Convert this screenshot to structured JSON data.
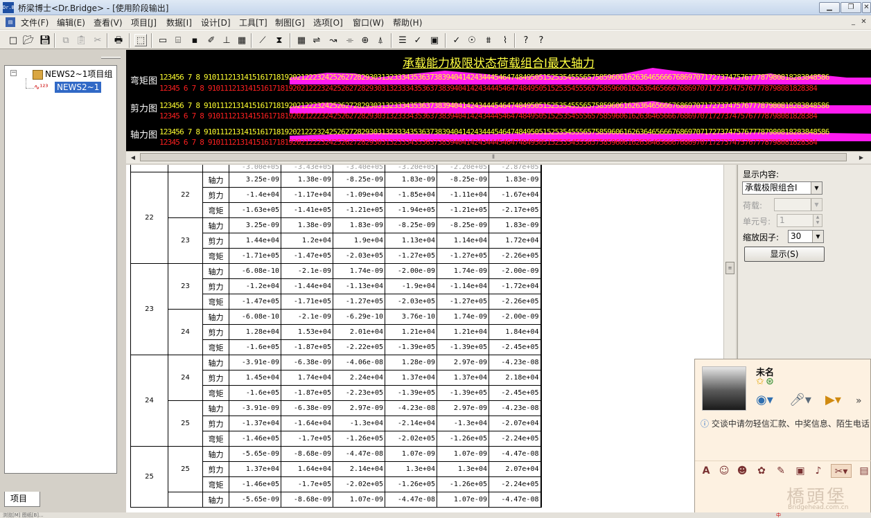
{
  "window": {
    "title": "桥梁博士<Dr.Bridge> - [使用阶段输出]",
    "icon": "app-icon",
    "buttons": [
      "minimize",
      "restore",
      "close"
    ],
    "mdi_buttons": [
      "mdi-minimize",
      "mdi-close"
    ]
  },
  "menu": [
    "文件(F)",
    "编辑(E)",
    "查看(V)",
    "项目[J]",
    "数据[I]",
    "设计[D]",
    "工具[T]",
    "制图[G]",
    "选项[O]",
    "窗口(W)",
    "帮助(H)"
  ],
  "toolbar_icons": [
    "new-file-icon",
    "open-folder-icon",
    "save-icon",
    "copy-icon",
    "paste-icon",
    "cut-icon",
    "print-icon",
    "select-icon",
    "page-icon",
    "open-icon",
    "disk-icon",
    "edit-icon",
    "structure-icon",
    "grid-icon",
    "beam-icon",
    "section-icon",
    "table-icon",
    "link-icon",
    "curve-icon",
    "tendon-icon",
    "node-icon",
    "support-icon",
    "lines-icon",
    "check-icon",
    "frame-icon",
    "pen-icon",
    "target-icon",
    "layers-icon",
    "spring-icon",
    "help-icon",
    "context-help-icon"
  ],
  "tree": {
    "root": "NEWS2~1项目组",
    "child": "NEWS2~1",
    "tab": "项目"
  },
  "diagram": {
    "title": "承载能力极限状态荷载组合I最大轴力",
    "rows": [
      {
        "label": "弯矩图",
        "top": "123456 7 8 91011121314151617181920212223242526272829303132333435363738394041424344454647484950515253545556575859606162636465666768697071727374757677787980818283848586",
        "bottom": "12345 6 7 8 9101112131415161718192021222324252627282930313233343536373839404142434445464748495051525354555657585960616263646566676869707172737475767778798081828384"
      },
      {
        "label": "剪力图",
        "top": "123456 7 8 91011121314151617181920212223242526272829303132333435363738394041424344454647484950515253545556575859606162636465666768697071727374757677787980818283848586",
        "bottom": "12345 6 7 8 9101112131415161718192021222324252627282930313233343536373839404142434445464748495051525354555657585960616263646566676869707172737475767778798081828384"
      },
      {
        "label": "轴力图",
        "top": "123456 7 8 91011121314151617181920212223242526272829303132333435363738394041424344454647484950515253545556575859606162636465666768697071727374757677787980818283848586",
        "bottom": "12345 6 7 8 9101112131415161718192021222324252627282930313233343536373839404142434445464748495051525354555657585960616263646566676869707172737475767778798081828384"
      }
    ]
  },
  "table": {
    "partial_row": [
      "-3.00e+05",
      "-3.43e+05",
      "-3.40e+05",
      "-3.20e+05",
      "-2.20e+05",
      "-2.87e+05"
    ],
    "groups": [
      {
        "elem": "22",
        "blocks": [
          {
            "node": "22",
            "rows": [
              {
                "type": "轴力",
                "v": [
                  "3.25e-09",
                  "1.38e-09",
                  "-8.25e-09",
                  "1.83e-09",
                  "-8.25e-09",
                  "1.83e-09"
                ]
              },
              {
                "type": "剪力",
                "v": [
                  "-1.4e+04",
                  "-1.17e+04",
                  "-1.09e+04",
                  "-1.85e+04",
                  "-1.11e+04",
                  "-1.67e+04"
                ]
              },
              {
                "type": "弯矩",
                "v": [
                  "-1.63e+05",
                  "-1.41e+05",
                  "-1.21e+05",
                  "-1.94e+05",
                  "-1.21e+05",
                  "-2.17e+05"
                ]
              }
            ]
          },
          {
            "node": "23",
            "rows": [
              {
                "type": "轴力",
                "v": [
                  "3.25e-09",
                  "1.38e-09",
                  "1.83e-09",
                  "-8.25e-09",
                  "-8.25e-09",
                  "1.83e-09"
                ]
              },
              {
                "type": "剪力",
                "v": [
                  "1.44e+04",
                  "1.2e+04",
                  "1.9e+04",
                  "1.13e+04",
                  "1.14e+04",
                  "1.72e+04"
                ]
              },
              {
                "type": "弯矩",
                "v": [
                  "-1.71e+05",
                  "-1.47e+05",
                  "-2.03e+05",
                  "-1.27e+05",
                  "-1.27e+05",
                  "-2.26e+05"
                ]
              }
            ]
          }
        ]
      },
      {
        "elem": "23",
        "blocks": [
          {
            "node": "23",
            "rows": [
              {
                "type": "轴力",
                "v": [
                  "-6.08e-10",
                  "-2.1e-09",
                  "1.74e-09",
                  "-2.00e-09",
                  "1.74e-09",
                  "-2.00e-09"
                ]
              },
              {
                "type": "剪力",
                "v": [
                  "-1.2e+04",
                  "-1.44e+04",
                  "-1.13e+04",
                  "-1.9e+04",
                  "-1.14e+04",
                  "-1.72e+04"
                ]
              },
              {
                "type": "弯矩",
                "v": [
                  "-1.47e+05",
                  "-1.71e+05",
                  "-1.27e+05",
                  "-2.03e+05",
                  "-1.27e+05",
                  "-2.26e+05"
                ]
              }
            ]
          },
          {
            "node": "24",
            "rows": [
              {
                "type": "轴力",
                "v": [
                  "-6.08e-10",
                  "-2.1e-09",
                  "-6.29e-10",
                  "3.76e-10",
                  "1.74e-09",
                  "-2.00e-09"
                ]
              },
              {
                "type": "剪力",
                "v": [
                  "1.28e+04",
                  "1.53e+04",
                  "2.01e+04",
                  "1.21e+04",
                  "1.21e+04",
                  "1.84e+04"
                ]
              },
              {
                "type": "弯矩",
                "v": [
                  "-1.6e+05",
                  "-1.87e+05",
                  "-2.22e+05",
                  "-1.39e+05",
                  "-1.39e+05",
                  "-2.45e+05"
                ]
              }
            ]
          }
        ]
      },
      {
        "elem": "24",
        "blocks": [
          {
            "node": "24",
            "rows": [
              {
                "type": "轴力",
                "v": [
                  "-3.91e-09",
                  "-6.38e-09",
                  "-4.06e-08",
                  "1.28e-09",
                  "2.97e-09",
                  "-4.23e-08"
                ]
              },
              {
                "type": "剪力",
                "v": [
                  "1.45e+04",
                  "1.74e+04",
                  "2.24e+04",
                  "1.37e+04",
                  "1.37e+04",
                  "2.18e+04"
                ]
              },
              {
                "type": "弯矩",
                "v": [
                  "-1.6e+05",
                  "-1.87e+05",
                  "-2.23e+05",
                  "-1.39e+05",
                  "-1.39e+05",
                  "-2.45e+05"
                ]
              }
            ]
          },
          {
            "node": "25",
            "rows": [
              {
                "type": "轴力",
                "v": [
                  "-3.91e-09",
                  "-6.38e-09",
                  "2.97e-09",
                  "-4.23e-08",
                  "2.97e-09",
                  "-4.23e-08"
                ]
              },
              {
                "type": "剪力",
                "v": [
                  "-1.37e+04",
                  "-1.64e+04",
                  "-1.3e+04",
                  "-2.14e+04",
                  "-1.3e+04",
                  "-2.07e+04"
                ]
              },
              {
                "type": "弯矩",
                "v": [
                  "-1.46e+05",
                  "-1.7e+05",
                  "-1.26e+05",
                  "-2.02e+05",
                  "-1.26e+05",
                  "-2.24e+05"
                ]
              }
            ]
          }
        ]
      },
      {
        "elem": "25",
        "blocks": [
          {
            "node": "25",
            "rows": [
              {
                "type": "轴力",
                "v": [
                  "-5.65e-09",
                  "-8.68e-09",
                  "-4.47e-08",
                  "1.07e-09",
                  "1.07e-09",
                  "-4.47e-08"
                ]
              },
              {
                "type": "剪力",
                "v": [
                  "1.37e+04",
                  "1.64e+04",
                  "2.14e+04",
                  "1.3e+04",
                  "1.3e+04",
                  "2.07e+04"
                ]
              },
              {
                "type": "弯矩",
                "v": [
                  "-1.46e+05",
                  "-1.7e+05",
                  "-2.02e+05",
                  "-1.26e+05",
                  "-1.26e+05",
                  "-2.24e+05"
                ]
              }
            ]
          },
          {
            "node": "",
            "rows": [
              {
                "type": "轴力",
                "v": [
                  "-5.65e-09",
                  "-8.68e-09",
                  "1.07e-09",
                  "-4.47e-08",
                  "1.07e-09",
                  "-4.47e-08"
                ]
              }
            ]
          }
        ]
      }
    ]
  },
  "panel": {
    "display_label": "显示内容:",
    "display_value": "承载极限组合I",
    "load_label": "荷载:",
    "load_value": "",
    "elem_label": "单元号:",
    "elem_value": "1",
    "scale_label": "缩放因子:",
    "scale_value": "30",
    "show_button": "显示(S)"
  },
  "qq": {
    "name": "未名",
    "notice": "交谈中请勿轻信汇款、中奖信息、陌生电话",
    "watermark": "橋頭堡",
    "watermark_sub": "Bridgehead.com.cn"
  },
  "taskbar": {
    "left_text": "浏览[M] 图纸[B]...",
    "right_text": "中"
  }
}
